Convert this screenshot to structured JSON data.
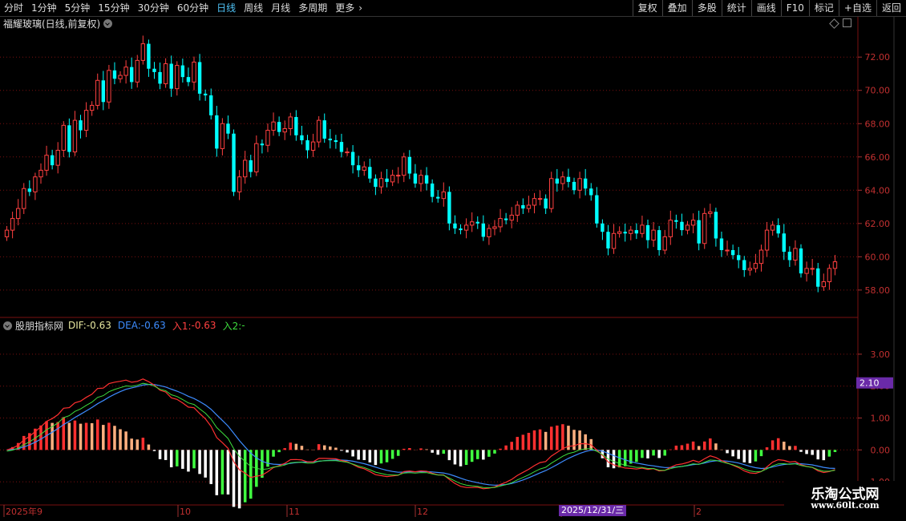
{
  "toolbar": {
    "periods": [
      "分时",
      "1分钟",
      "5分钟",
      "15分钟",
      "30分钟",
      "60分钟",
      "日线",
      "周线",
      "月线",
      "多周期",
      "更多"
    ],
    "active": "日线",
    "more_arrow": "›",
    "right": [
      "复权",
      "叠加",
      "多股",
      "统计",
      "画线",
      "F10",
      "标记",
      "+自选",
      "返回"
    ]
  },
  "main": {
    "title": "福耀玻璃(日线,前复权)",
    "price_labels": [
      "72.00",
      "70.00",
      "68.00",
      "66.00",
      "64.00",
      "62.00",
      "60.00",
      "58.00"
    ]
  },
  "macd": {
    "title": "股朋指标网",
    "dif_label": "DIF:",
    "dif_value": "-0.63",
    "dea_label": "DEA:",
    "dea_value": "-0.63",
    "in1_label": "入1:",
    "in1_value": "-0.63",
    "in2_label": "入2:",
    "in2_value": "-",
    "axis_labels": [
      "3.00",
      "2.00",
      "1.00",
      "0.00",
      "-1.00"
    ],
    "cursor_value": "2.10"
  },
  "xaxis": {
    "labels": [
      "2025年9",
      "10",
      "11",
      "12",
      "1",
      "2"
    ],
    "highlight": "2025/12/31/三"
  },
  "watermark": {
    "line1": "乐淘公式网",
    "line2": "www.60lt.com"
  },
  "colors": {
    "up": "#ff4040",
    "down": "#00ffff",
    "grid": "#7a1010",
    "dif": "#e8e8e8",
    "dea": "#3d8cff"
  },
  "chart_data": {
    "type": "candlestick",
    "yrange": [
      56.5,
      73.6
    ],
    "closes": [
      61.6,
      62.3,
      62.9,
      64.1,
      63.9,
      64.8,
      65.2,
      66.1,
      65.5,
      66.4,
      67.9,
      66.3,
      68.2,
      67.6,
      68.8,
      69.1,
      70.6,
      69.3,
      71.2,
      70.7,
      70.9,
      71.4,
      70.5,
      71.8,
      72.8,
      71.3,
      71.1,
      70.4,
      71.6,
      70.1,
      71.5,
      70.8,
      70.5,
      71.7,
      69.8,
      69.7,
      68.5,
      66.5,
      68.0,
      67.4,
      63.9,
      64.8,
      65.8,
      65.1,
      66.8,
      66.7,
      67.6,
      68.1,
      67.5,
      67.7,
      68.4,
      67.3,
      67.0,
      66.4,
      66.9,
      68.2,
      67.1,
      67.0,
      66.9,
      66.3,
      66.3,
      65.5,
      65.2,
      65.4,
      64.7,
      64.2,
      64.7,
      64.5,
      64.9,
      64.9,
      66.0,
      65.0,
      64.4,
      64.9,
      64.4,
      63.6,
      63.5,
      63.9,
      62.0,
      61.7,
      61.6,
      61.9,
      62.1,
      62.0,
      61.2,
      61.7,
      61.8,
      62.3,
      62.2,
      62.5,
      63.1,
      62.9,
      63.1,
      63.5,
      63.5,
      62.9,
      64.7,
      64.4,
      64.8,
      64.5,
      64.0,
      64.7,
      64.1,
      63.7,
      62.0,
      61.5,
      60.5,
      61.4,
      61.5,
      61.4,
      61.6,
      61.4,
      61.9,
      61.0,
      61.6,
      60.4,
      61.2,
      62.2,
      62.1,
      61.6,
      61.9,
      62.2,
      60.8,
      62.6,
      62.7,
      61.1,
      60.4,
      60.4,
      60.1,
      59.8,
      59.2,
      59.3,
      59.6,
      60.4,
      61.6,
      61.9,
      61.4,
      60.3,
      59.8,
      60.5,
      59.0,
      59.3,
      59.3,
      58.2,
      58.5,
      59.3,
      59.7
    ],
    "series": [
      {
        "name": "DIF",
        "label": "DIF"
      },
      {
        "name": "DEA",
        "label": "DEA"
      }
    ]
  }
}
